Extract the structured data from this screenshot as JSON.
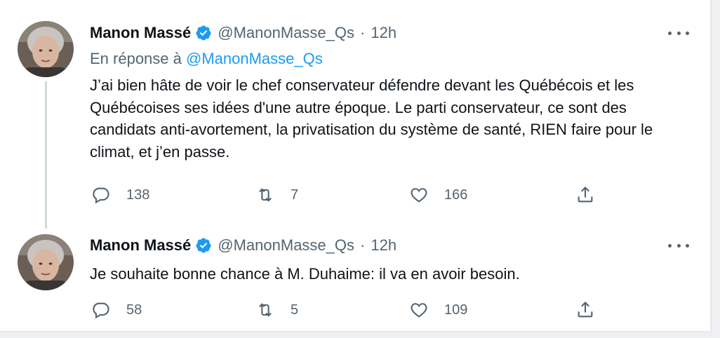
{
  "tweets": [
    {
      "author_name": "Manon Massé",
      "handle": "@ManonMasse_Qs",
      "separator": "·",
      "time": "12h",
      "reply_prefix": "En réponse à",
      "reply_handle": "@ManonMasse_Qs",
      "text": "J’ai bien hâte de voir le chef conservateur défendre devant les Québécois et les Québécoises ses idées d'une autre époque. Le parti conservateur, ce sont des candidats anti-avortement, la privatisation du système de santé, RIEN faire pour le climat, et j’en passe.",
      "replies": "138",
      "retweets": "7",
      "likes": "166"
    },
    {
      "author_name": "Manon Massé",
      "handle": "@ManonMasse_Qs",
      "separator": "·",
      "time": "12h",
      "text": "Je souhaite bonne chance à M. Duhaime: il va en avoir besoin.",
      "replies": "58",
      "retweets": "5",
      "likes": "109"
    }
  ],
  "icons": {
    "verified": "verified-badge-icon",
    "reply": "reply-icon",
    "retweet": "retweet-icon",
    "like": "heart-icon",
    "share": "share-icon",
    "more": "more-icon"
  },
  "colors": {
    "link": "#1d9bf0",
    "muted": "#536471",
    "text": "#0f1419",
    "thread_line": "#cfd9de"
  }
}
